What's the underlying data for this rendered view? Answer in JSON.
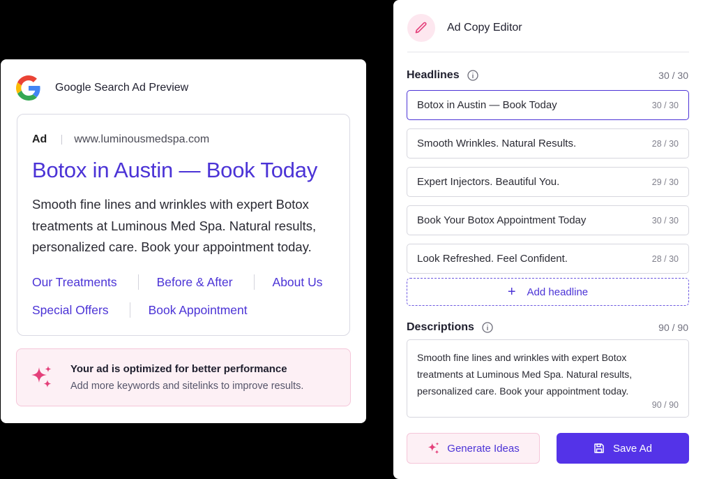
{
  "preview": {
    "title": "Google Search Ad Preview",
    "ad_label": "Ad",
    "url": "www.luminousmedspa.com",
    "headline": "Botox in Austin — Book Today",
    "description": "Smooth fine lines and wrinkles with expert Botox treatments at Luminous Med Spa. Natural results, personalized care. Book your appointment today.",
    "sitelinks": [
      "Our Treatments",
      "Before & After",
      "About Us",
      "Special Offers",
      "Book Appointment"
    ],
    "optimize_title": "Your ad is optimized for better performance",
    "optimize_sub": "Add more keywords and sitelinks to improve results."
  },
  "editor": {
    "title": "Ad Copy Editor",
    "headlines_label": "Headlines",
    "headlines_count": "30 / 30",
    "headlines": [
      {
        "text": "Botox in Austin — Book Today",
        "count": "30 / 30"
      },
      {
        "text": "Smooth Wrinkles. Natural Results.",
        "count": "28 / 30"
      },
      {
        "text": "Expert Injectors. Beautiful You.",
        "count": "29 / 30"
      },
      {
        "text": "Book Your Botox Appointment Today",
        "count": "30 / 30"
      },
      {
        "text": "Look Refreshed. Feel Confident.",
        "count": "28 / 30"
      }
    ],
    "add_headline": "Add headline",
    "descriptions_label": "Descriptions",
    "descriptions_count": "90 / 90",
    "description_text": "Smooth fine lines and wrinkles with expert Botox treatments at Luminous Med Spa. Natural results, personalized care. Book your appointment today.",
    "description_field_count": "90 / 90",
    "generate_label": "Generate Ideas",
    "save_label": "Save Ad"
  },
  "colors": {
    "accent": "#4b33d6",
    "button_primary": "#5433e8",
    "pink_bg": "#fdf0f5",
    "pink_icon": "#e4407a"
  },
  "icons": [
    "google-logo",
    "sparkle-icon",
    "pencil-icon",
    "info-icon",
    "plus-icon",
    "save-icon"
  ]
}
